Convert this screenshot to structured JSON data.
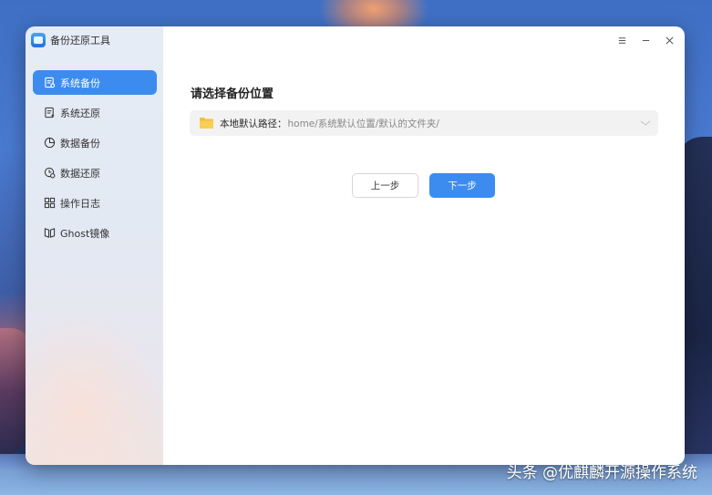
{
  "app": {
    "title": "备份还原工具",
    "accent": "#3c8cf0"
  },
  "sidebar": {
    "items": [
      {
        "label": "系统备份",
        "icon": "system-backup-icon",
        "active": true
      },
      {
        "label": "系统还原",
        "icon": "system-restore-icon",
        "active": false
      },
      {
        "label": "数据备份",
        "icon": "data-backup-icon",
        "active": false
      },
      {
        "label": "数据还原",
        "icon": "data-restore-icon",
        "active": false
      },
      {
        "label": "操作日志",
        "icon": "grid-icon",
        "active": false
      },
      {
        "label": "Ghost镜像",
        "icon": "ghost-image-icon",
        "active": false
      }
    ]
  },
  "window_controls": [
    "menu-icon",
    "minimize-icon",
    "close-icon"
  ],
  "main": {
    "heading": "请选择备份位置",
    "location": {
      "label": "本地默认路径：",
      "value": "home/系统默认位置/默认的文件夹/"
    },
    "prev_button": "上一步",
    "next_button": "下一步"
  },
  "watermark": "头条 @优麒麟开源操作系统"
}
